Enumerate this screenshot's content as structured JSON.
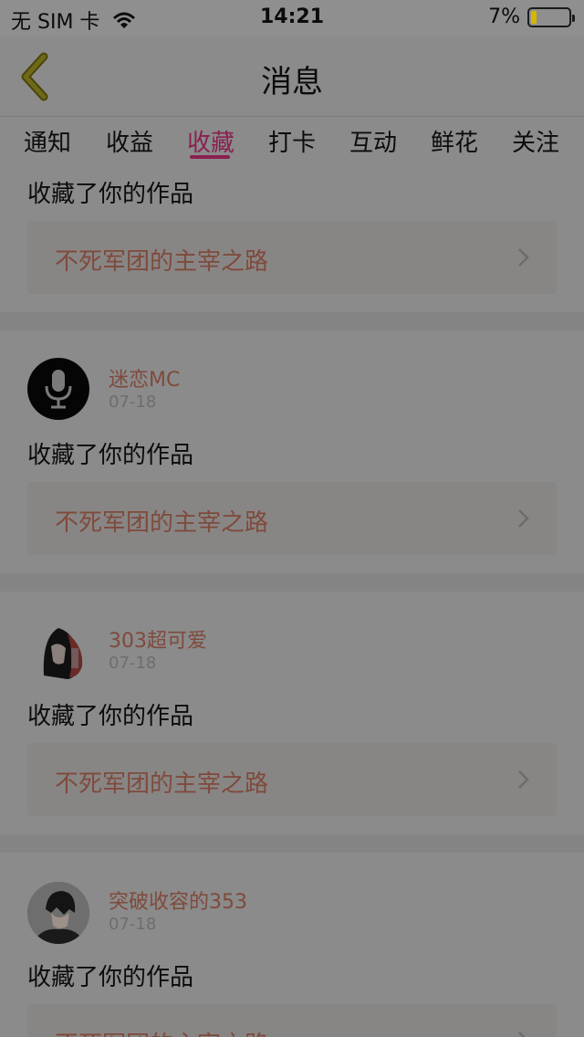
{
  "status": {
    "carrier": "无 SIM 卡",
    "time": "14:21",
    "battery": "7%",
    "battery_level": 0.07
  },
  "header": {
    "title": "消息"
  },
  "tabs": [
    {
      "label": "通知"
    },
    {
      "label": "收益"
    },
    {
      "label": "收藏"
    },
    {
      "label": "打卡"
    },
    {
      "label": "互动"
    },
    {
      "label": "鲜花"
    },
    {
      "label": "关注"
    }
  ],
  "active_tab": "收藏",
  "messages": [
    {
      "user": "",
      "date": "",
      "action": "收藏了你的作品",
      "work": "不死军团的主宰之路"
    },
    {
      "user": "迷恋MC",
      "date": "07-18",
      "action": "收藏了你的作品",
      "work": "不死军团的主宰之路",
      "avatar": "microphone-avatar"
    },
    {
      "user": "303超可爱",
      "date": "07-18",
      "action": "收藏了你的作品",
      "work": "不死军团的主宰之路",
      "avatar": "anime-hood-avatar"
    },
    {
      "user": "突破收容的353",
      "date": "07-18",
      "action": "收藏了你的作品",
      "work": "不死军团的主宰之路",
      "avatar": "anime-boy-avatar"
    }
  ],
  "colors": {
    "accent": "#8a2050",
    "link": "#7f4a3c",
    "overlay_bg": "#8b8b8b"
  }
}
